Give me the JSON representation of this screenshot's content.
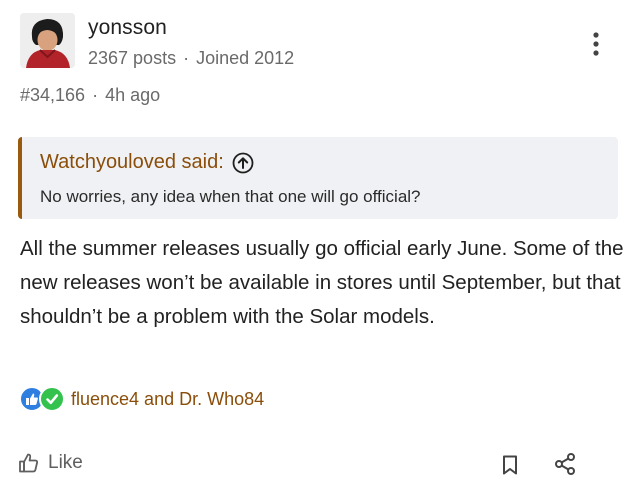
{
  "author": {
    "username": "yonsson",
    "posts": "2367 posts",
    "joined": "Joined 2012",
    "separator": "·"
  },
  "post_info": {
    "number": "#34,166",
    "time": "4h ago",
    "separator": "·"
  },
  "quote": {
    "author": "Watchyouloved said:",
    "text": "No worries, any idea when that one will go official?"
  },
  "body": "All the summer releases usually go official early June. Some of the new releases won’t be available in stores until September, but that shouldn’t be a problem with the Solar models.",
  "reactions": {
    "users": "fluence4 and Dr. Who84",
    "icons": [
      "thumbs-up-icon",
      "checkmark-icon"
    ]
  },
  "footer": {
    "like_label": "Like",
    "icons": [
      "thumbs-up-icon",
      "bookmark-icon",
      "share-icon"
    ]
  },
  "colors": {
    "accent": "#8a4e0a",
    "quote_border": "#9a5a0d",
    "quote_bg": "#f0f1f4",
    "like_blue": "#2f7fe0",
    "check_green": "#33c24d",
    "muted": "#6a6a6a"
  }
}
